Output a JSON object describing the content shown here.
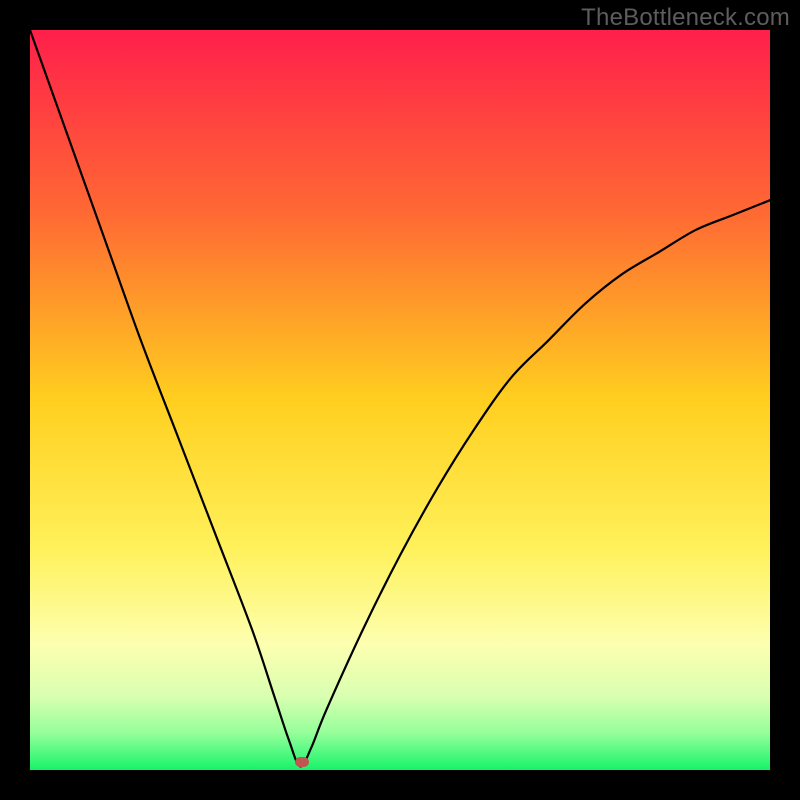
{
  "watermark": "TheBottleneck.com",
  "chart_data": {
    "type": "line",
    "title": "",
    "xlabel": "",
    "ylabel": "",
    "xlim": [
      0,
      100
    ],
    "ylim": [
      0,
      100
    ],
    "gradient_stops": [
      {
        "offset": 0,
        "color": "#ff1f4b"
      },
      {
        "offset": 0.25,
        "color": "#ff6a33"
      },
      {
        "offset": 0.5,
        "color": "#ffcf1f"
      },
      {
        "offset": 0.7,
        "color": "#fff15a"
      },
      {
        "offset": 0.83,
        "color": "#fdffb0"
      },
      {
        "offset": 0.9,
        "color": "#d9ffb0"
      },
      {
        "offset": 0.95,
        "color": "#95ff9a"
      },
      {
        "offset": 1.0,
        "color": "#17f36a"
      }
    ],
    "series": [
      {
        "name": "bottleneck-curve",
        "x": [
          0,
          5,
          10,
          15,
          20,
          25,
          30,
          33,
          35,
          36.5,
          38,
          40,
          45,
          50,
          55,
          60,
          65,
          70,
          75,
          80,
          85,
          90,
          95,
          100
        ],
        "y": [
          100,
          86,
          72,
          58,
          45,
          32,
          19,
          10,
          4,
          0.5,
          3,
          8,
          19,
          29,
          38,
          46,
          53,
          58,
          63,
          67,
          70,
          73,
          75,
          77
        ]
      }
    ],
    "marker": {
      "x": 36.8,
      "y": 1.1
    },
    "legend": []
  }
}
